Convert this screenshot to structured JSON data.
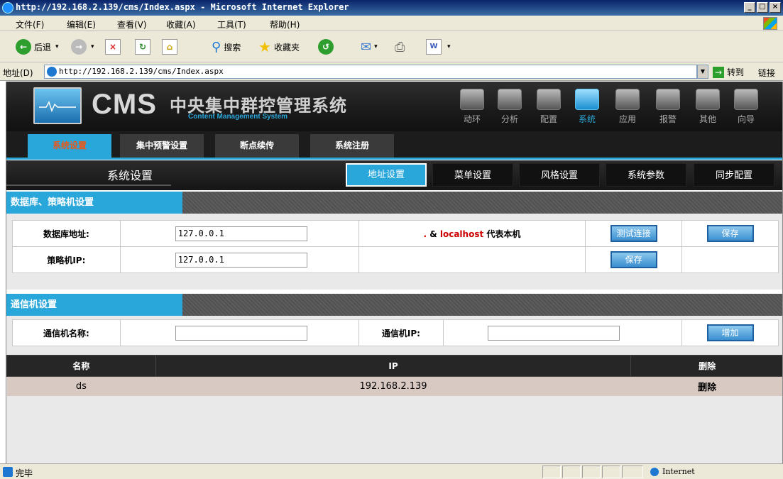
{
  "window": {
    "title": "http://192.168.2.139/cms/Index.aspx - Microsoft Internet Explorer",
    "minimize": "_",
    "restore": "□",
    "close": "×"
  },
  "menu": [
    "文件(F)",
    "编辑(E)",
    "查看(V)",
    "收藏(A)",
    "工具(T)",
    "帮助(H)"
  ],
  "toolbar": {
    "back": "后退",
    "search": "搜索",
    "favorites": "收藏夹"
  },
  "address": {
    "label": "地址(D)",
    "url": "http://192.168.2.139/cms/Index.aspx",
    "go": "转到",
    "links": "链接"
  },
  "banner": {
    "logo": "CMS",
    "title_cn": "中央集中群控管理系统",
    "title_en": "Content Management System",
    "nav": [
      "动环",
      "分析",
      "配置",
      "系统",
      "应用",
      "报警",
      "其他",
      "向导"
    ],
    "active_nav": "系统"
  },
  "tabs1": [
    "系统设置",
    "集中预警设置",
    "断点续传",
    "系统注册"
  ],
  "tabs2": {
    "section": "系统设置",
    "items": [
      "地址设置",
      "菜单设置",
      "风格设置",
      "系统参数",
      "同步配置"
    ]
  },
  "db_panel": {
    "title": "数据库、策略机设置",
    "db_label": "数据库地址:",
    "db_value": "127.0.0.1",
    "hint_prefix": ". ",
    "hint_amp": "&",
    "hint_local": "localhost",
    "hint_suffix": "代表本机",
    "test_button": "测试连接",
    "save_button": "保存",
    "policy_label": "策略机IP:",
    "policy_value": "127.0.0.1",
    "save_button2": "保存"
  },
  "comm_panel": {
    "title": "通信机设置",
    "name_label": "通信机名称:",
    "name_value": "",
    "ip_label": "通信机IP:",
    "ip_value": "",
    "add_button": "增加",
    "columns": [
      "名称",
      "IP",
      "删除"
    ],
    "rows": [
      {
        "name": "ds",
        "ip": "192.168.2.139",
        "action": "删除"
      }
    ]
  },
  "status": {
    "text": "完毕",
    "zone": "Internet"
  }
}
